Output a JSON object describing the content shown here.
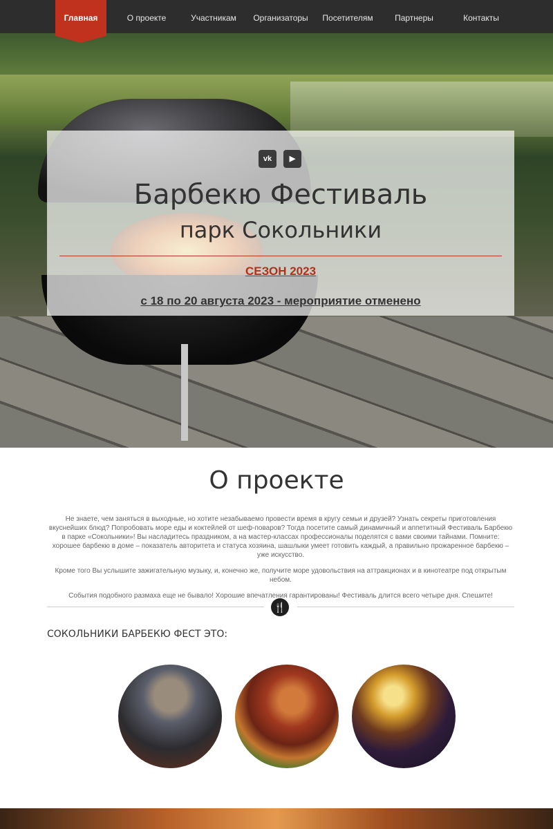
{
  "nav": {
    "items": [
      {
        "label": "Главная",
        "active": true
      },
      {
        "label": "О проекте"
      },
      {
        "label": "Участникам"
      },
      {
        "label": "Организаторы"
      },
      {
        "label": "Посетителям"
      },
      {
        "label": "Партнеры"
      },
      {
        "label": "Контакты"
      }
    ]
  },
  "hero": {
    "social": [
      {
        "icon": "vk-icon",
        "label": "vk"
      },
      {
        "icon": "youtube-icon",
        "label": "▶"
      }
    ],
    "title": "Барбекю Фестиваль",
    "subtitle": "парк Сокольники",
    "season": "СЕЗОН 2023",
    "dates": "с 18 по 20 августа 2023 - мероприятие отменено"
  },
  "about": {
    "title": "О проекте",
    "paragraphs": [
      "Не знаете, чем заняться в выходные, но хотите незабываемо провести время в кругу семьи и друзей? Узнать секреты приготовления вкуснейших блюд? Попробовать море еды и коктейлей от шеф-поваров? Тогда посетите самый динамичный и аппетитный Фестиваль Барбекю в парке «Сокольники»! Вы насладитесь праздником, а на мастер-классах профессионалы поделятся с вами своими тайнами. Помните: хорошее барбекю в доме – показатель авторитета и статуса хозяина, шашлыки умеет готовить каждый, а правильно прожаренное барбекю – уже искусство.",
      "Кроме того Вы услышите зажигательную музыку, и, конечно же, получите море удовольствия на аттракционах и в кинотеатре под открытым небом.",
      "События подобного размаха еще не бывало! Хорошие впечатления гарантированы! Фестиваль длится всего четыре дня. Спешите!"
    ],
    "divider_icon": "fork-knife-icon",
    "divider_glyph": "🍴"
  },
  "features": {
    "heading": "СОКОЛЬНИКИ БАРБЕКЮ ФЕСТ ЭТО:",
    "items": [
      {
        "name": "grill-chef-photo"
      },
      {
        "name": "sausages-photo"
      },
      {
        "name": "trumpet-player-photo"
      }
    ]
  }
}
